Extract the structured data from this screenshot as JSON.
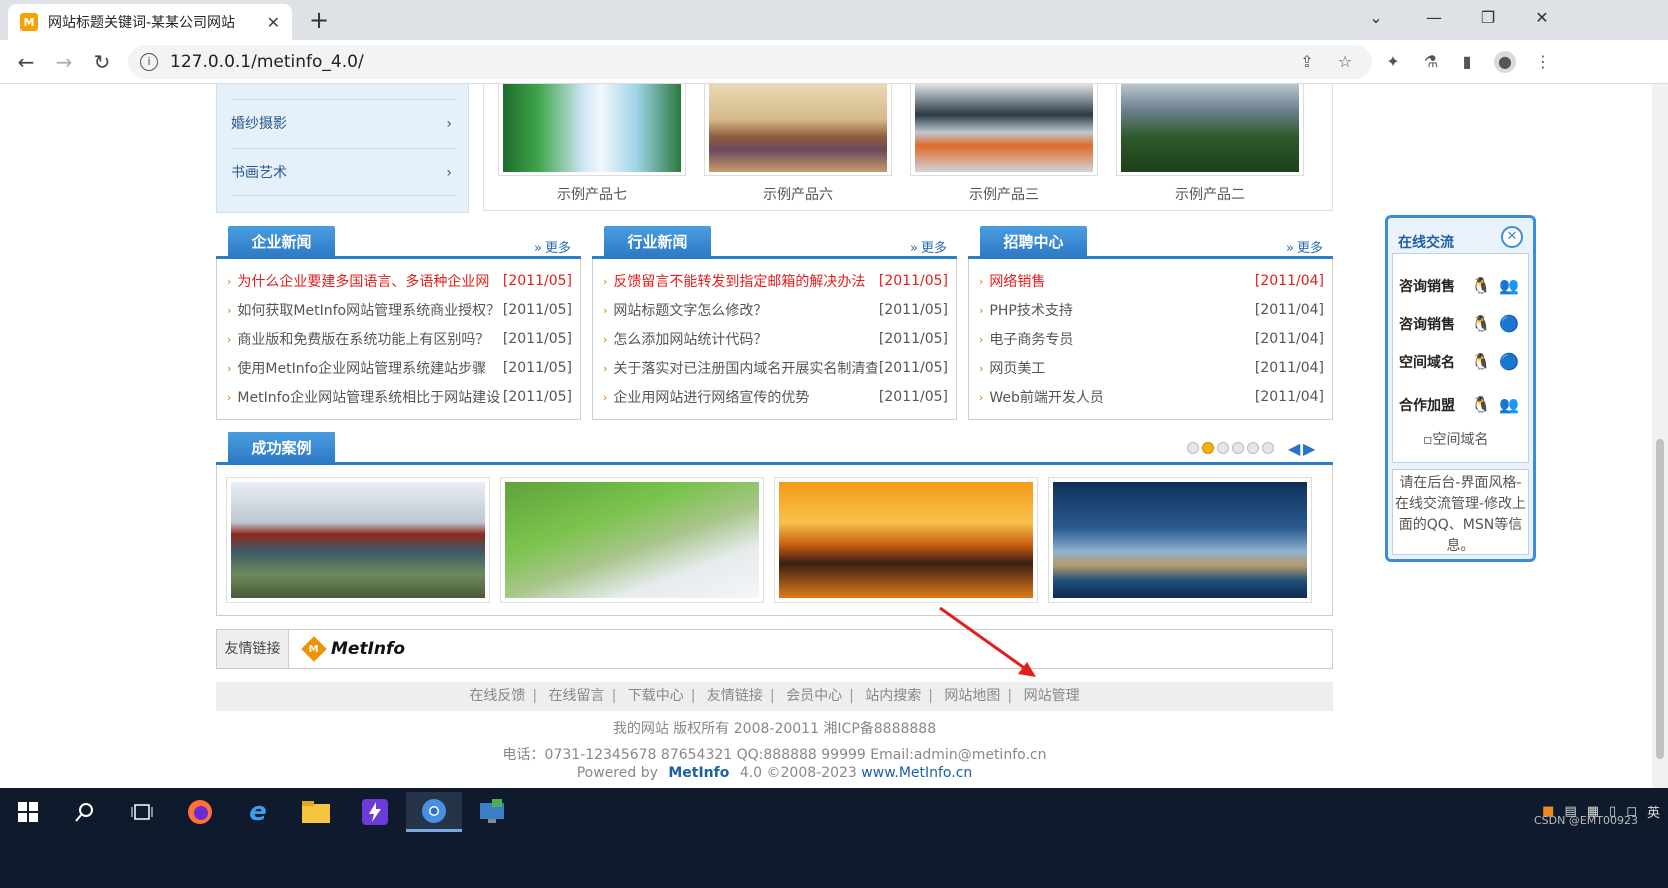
{
  "browser": {
    "tab_title": "网站标题关键词-某某公司网站",
    "url": "127.0.0.1/metinfo_4.0/",
    "new_tab": "+",
    "close_tab": "✕"
  },
  "sidebar": {
    "items": [
      {
        "label": "婚纱摄影"
      },
      {
        "label": "书画艺术"
      }
    ]
  },
  "products": [
    {
      "label": "示例产品七"
    },
    {
      "label": "示例产品六"
    },
    {
      "label": "示例产品三"
    },
    {
      "label": "示例产品二"
    }
  ],
  "news_boxes": [
    {
      "title": "企业新闻",
      "more": "更多",
      "items": [
        {
          "text": "为什么企业要建多国语言、多语种企业网",
          "date": "[2011/05]",
          "hot": true
        },
        {
          "text": "如何获取MetInfo网站管理系统商业授权？",
          "date": "[2011/05]",
          "hot": false
        },
        {
          "text": "商业版和免费版在系统功能上有区别吗？",
          "date": "[2011/05]",
          "hot": false
        },
        {
          "text": "使用MetInfo企业网站管理系统建站步骤",
          "date": "[2011/05]",
          "hot": false
        },
        {
          "text": "MetInfo企业网站管理系统相比于网站建设公",
          "date": "[2011/05]",
          "hot": false
        }
      ]
    },
    {
      "title": "行业新闻",
      "more": "更多",
      "items": [
        {
          "text": "反馈留言不能转发到指定邮箱的解决办法",
          "date": "[2011/05]",
          "hot": true
        },
        {
          "text": "网站标题文字怎么修改？",
          "date": "[2011/05]",
          "hot": false
        },
        {
          "text": "怎么添加网站统计代码？",
          "date": "[2011/05]",
          "hot": false
        },
        {
          "text": "关于落实对已注册国内域名开展实名制清查",
          "date": "[2011/05]",
          "hot": false
        },
        {
          "text": "企业用网站进行网络宣传的优势",
          "date": "[2011/05]",
          "hot": false
        }
      ]
    },
    {
      "title": "招聘中心",
      "more": "更多",
      "items": [
        {
          "text": "网络销售",
          "date": "[2011/04]",
          "hot": true
        },
        {
          "text": "PHP技术支持",
          "date": "[2011/04]",
          "hot": false
        },
        {
          "text": "电子商务专员",
          "date": "[2011/04]",
          "hot": false
        },
        {
          "text": "网页美工",
          "date": "[2011/04]",
          "hot": false
        },
        {
          "text": "Web前端开发人员",
          "date": "[2011/04]",
          "hot": false
        }
      ]
    }
  ],
  "cases": {
    "title": "成功案例",
    "dots": 6,
    "active_dot": 2
  },
  "friend_links": {
    "label": "友情链接",
    "logo_text": "MetInfo",
    "logo_mark": "M"
  },
  "footer": {
    "nav": [
      "在线反馈",
      "在线留言",
      "下载中心",
      "友情链接",
      "会员中心",
      "站内搜索",
      "网站地图",
      "网站管理"
    ],
    "copyright": "我的网站 版权所有 2008-20011 湘ICP备8888888",
    "contact": "电话：0731-12345678 87654321 QQ:888888 99999 Email:admin@metinfo.cn",
    "powered_prefix": "Powered by",
    "powered_brand": "MetInfo",
    "powered_version": "4.0 ©2008-2023",
    "powered_site": "www.MetInfo.cn"
  },
  "chat": {
    "title": "在线交流",
    "rows": [
      {
        "label": "咨询销售"
      },
      {
        "label": "咨询销售"
      },
      {
        "label": "空间域名"
      },
      {
        "label": "合作加盟"
      }
    ],
    "domain_img_alt": "空间域名",
    "note": "请在后台-界面风格-在线交流管理-修改上面的QQ、MSN等信息。"
  },
  "taskbar": {
    "watermark": "CSDN @EMT00923",
    "ime": "英"
  },
  "colors": {
    "accent": "#2d7ec4",
    "hot": "#e51c1c",
    "bullet": "#e47a00"
  }
}
